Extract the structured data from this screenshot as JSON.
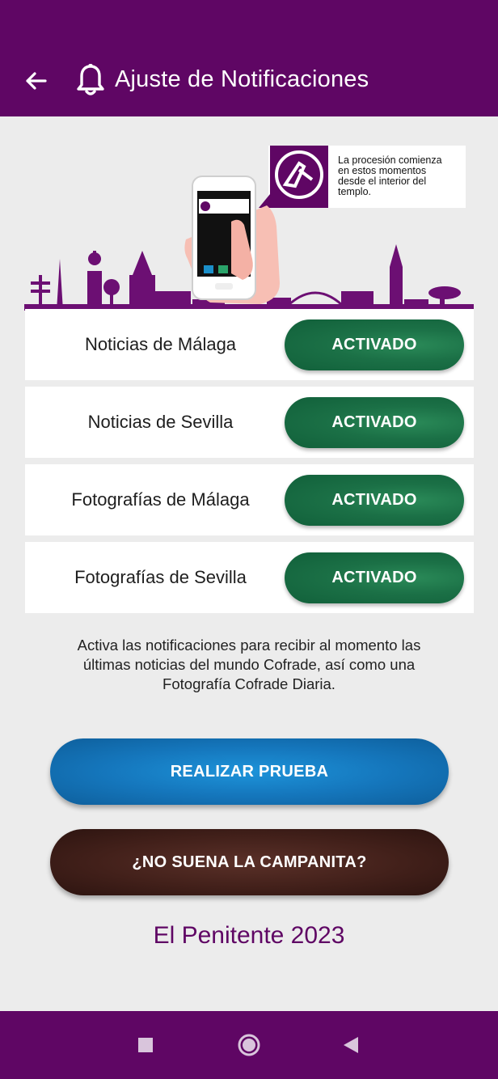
{
  "app_bar": {
    "title": "Ajuste de Notificaciones",
    "back_icon": "arrow-left-icon",
    "title_icon": "bell-icon"
  },
  "hero": {
    "notification_text_line1": "La procesión comienza",
    "notification_text_line2": "en estos momentos",
    "notification_text_line3": "desde el interior del",
    "notification_text_line4": "templo."
  },
  "settings": [
    {
      "label": "Noticias de Málaga",
      "state": "ACTIVADO"
    },
    {
      "label": "Noticias de Sevilla",
      "state": "ACTIVADO"
    },
    {
      "label": "Fotografías de Málaga",
      "state": "ACTIVADO"
    },
    {
      "label": "Fotografías de Sevilla",
      "state": "ACTIVADO"
    }
  ],
  "info": {
    "line1": "Activa las notificaciones para recibir al momento las",
    "line2": "últimas noticias del mundo Cofrade, así como una",
    "line3": "Fotografía Cofrade Diaria."
  },
  "buttons": {
    "test_label": "REALIZAR PRUEBA",
    "bell_label": "¿NO SUENA LA CAMPANITA?"
  },
  "footer": {
    "text": "El Penitente 2023"
  },
  "nav": {
    "recents_icon": "square-icon",
    "home_icon": "circle-icon",
    "back_icon": "triangle-back-icon"
  },
  "colors": {
    "brand_purple": "#5f0664",
    "toggle_green": "#1b7046",
    "test_blue": "#1577bd",
    "bell_brown": "#42201a"
  }
}
